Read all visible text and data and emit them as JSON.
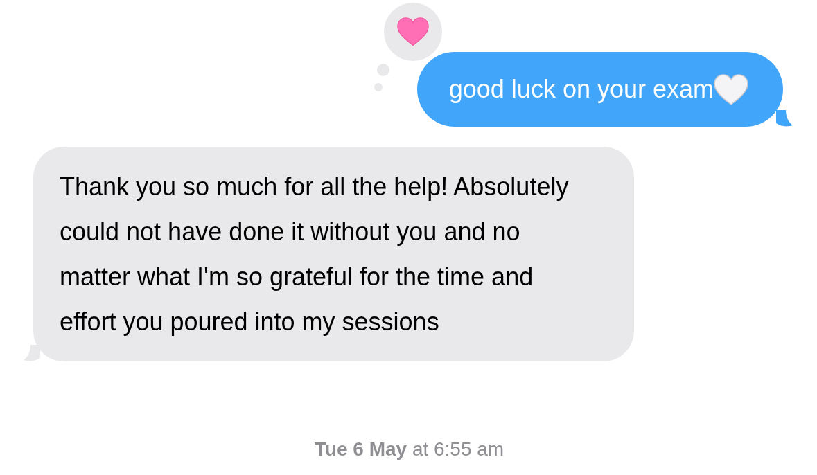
{
  "messages": [
    {
      "kind": "sent",
      "text": "good luck on your exam",
      "emoji": {
        "kind": "white-heart"
      },
      "reaction": {
        "kind": "heart"
      }
    },
    {
      "kind": "received",
      "text": "Thank you so much for all the help! Absolutely could not have done it without you and no matter what I'm so grateful for the time and effort you poured into my sessions"
    }
  ],
  "timestamp": "**Tue 6 May** at 6:55 am"
}
